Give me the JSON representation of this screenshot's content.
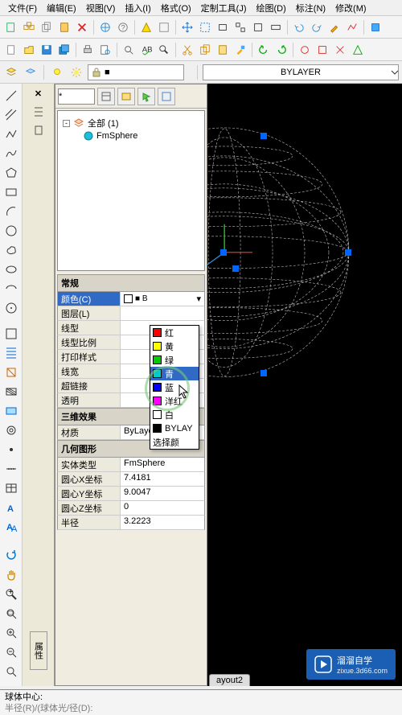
{
  "menubar": {
    "file": "文件(F)",
    "edit": "编辑(E)",
    "view": "视图(V)",
    "insert": "插入(I)",
    "format": "格式(O)",
    "custom": "定制工具(J)",
    "draw": "绘图(D)",
    "annotate": "标注(N)",
    "modify": "修改(M)"
  },
  "layer_linetype": "BYLAYER",
  "side_tab": "属性",
  "panel": {
    "filter_value": "*",
    "tree_root": "全部 (1)",
    "tree_item": "FmSphere"
  },
  "sections": {
    "general": "常规",
    "effects3d": "三维效果",
    "geometry": "几何图形"
  },
  "props": {
    "color_label": "颜色(C)",
    "color_val": "■ B",
    "layer_label": "图层(L)",
    "linetype_label": "线型",
    "ltscale_label": "线型比例",
    "plotstyle_label": "打印样式",
    "lineweight_label": "线宽",
    "hyperlink_label": "超链接",
    "transparency_label": "透明",
    "material_label": "材质",
    "material_val": "ByLayer",
    "entity_label": "实体类型",
    "entity_val": "FmSphere",
    "cx_label": "圆心X坐标",
    "cx_val": "7.4181",
    "cy_label": "圆心Y坐标",
    "cy_val": "9.0047",
    "cz_label": "圆心Z坐标",
    "cz_val": "0",
    "radius_label": "半径",
    "radius_val": "3.2223"
  },
  "color_dropdown": {
    "items": [
      {
        "name": "红",
        "hex": "#f00"
      },
      {
        "name": "黄",
        "hex": "#ff0"
      },
      {
        "name": "绿",
        "hex": "#0c0"
      },
      {
        "name": "青",
        "hex": "#0cc"
      },
      {
        "name": "蓝",
        "hex": "#00f"
      },
      {
        "name": "洋红",
        "hex": "#f0f"
      },
      {
        "name": "白",
        "hex": "#fff"
      },
      {
        "name": "BYLAY",
        "hex": "#000"
      },
      {
        "name": "选择颜",
        "hex": ""
      }
    ],
    "hover_index": 3
  },
  "tabs": {
    "layout2": "ayout2"
  },
  "cmd": {
    "line1": "球体中心:",
    "line2": "半径(R)/(球体光/径(D):"
  },
  "watermark": {
    "title": "溜溜自学",
    "sub": "zixue.3d66.com"
  }
}
